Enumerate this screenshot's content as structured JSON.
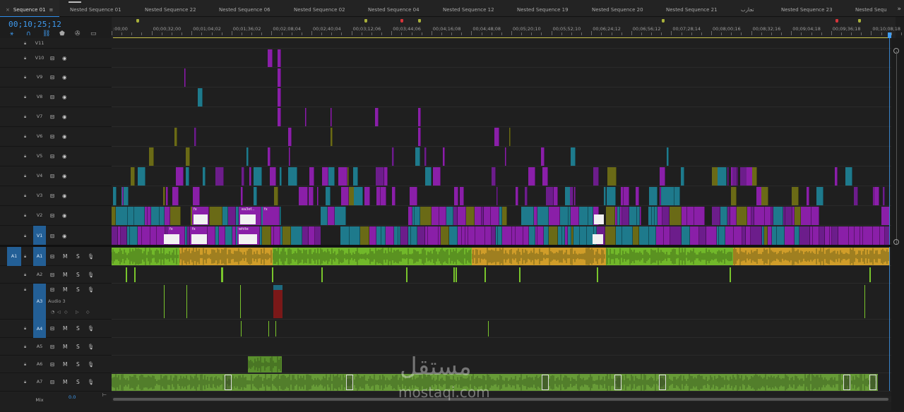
{
  "tabs": [
    {
      "label": "Sequence 01",
      "active": true
    },
    {
      "label": "Nested Sequence 01"
    },
    {
      "label": "Nested Sequence 22"
    },
    {
      "label": "Nested Sequence 06"
    },
    {
      "label": "Nested Sequence 02"
    },
    {
      "label": "Nested Sequence 04"
    },
    {
      "label": "Nested Sequence 12"
    },
    {
      "label": "Nested Sequence 19"
    },
    {
      "label": "Nested Sequence 20"
    },
    {
      "label": "Nested Sequence 21"
    },
    {
      "label": "تجارب"
    },
    {
      "label": "Nested Sequence 23"
    },
    {
      "label": "Nested Sequ"
    }
  ],
  "tab_close_glyph": "×",
  "tab_menu_glyph": "≡",
  "tab_overflow_glyph": "»",
  "timecode": "00;10;25;12",
  "ruler_labels": [
    "00;00",
    "00;00;32;00",
    "00;01;04;02",
    "00;01;36;02",
    "00;02;08;04",
    "00;02;40;04",
    "00;03;12;06",
    "00;03;44;06",
    "00;04;16;08",
    "00;04;48;08",
    "00;05;20;10",
    "00;05;52;10",
    "00;06;24;12",
    "00;06;56;12",
    "00;07;28;14",
    "00;08;00;16",
    "00;08;32;16",
    "00;09;04;18",
    "00;09;36;18",
    "00;10;08;18"
  ],
  "ruler_label_prefix": ":",
  "tools": {
    "snap_icon": "snap-icon",
    "linked_selection_icon": "magnet-link-icon",
    "add_marker_icon": "marker-icon",
    "settings_icon": "wrench-icon",
    "captions_icon": "captions-icon",
    "insert_icon": "sequence-insert-icon"
  },
  "video_tracks": [
    {
      "name": "V11"
    },
    {
      "name": "V10"
    },
    {
      "name": "V9"
    },
    {
      "name": "V8"
    },
    {
      "name": "V7"
    },
    {
      "name": "V6"
    },
    {
      "name": "V5"
    },
    {
      "name": "V4"
    },
    {
      "name": "V3"
    },
    {
      "name": "V2"
    },
    {
      "name": "V1",
      "targeted": true
    }
  ],
  "audio_tracks": [
    {
      "name": "A1",
      "targeted": true,
      "source_patch": "A1"
    },
    {
      "name": "A2"
    },
    {
      "name": "A3",
      "targeted": true,
      "label": "Audio 3"
    },
    {
      "name": "A4",
      "targeted": true
    },
    {
      "name": "A5"
    },
    {
      "name": "A6"
    },
    {
      "name": "A7"
    }
  ],
  "mix": {
    "name": "Mix",
    "value": "0.0"
  },
  "audio_buttons": {
    "mute": "M",
    "solo": "S"
  },
  "clip_labels": {
    "fx": "fx",
    "clip_a": "ea3ef...",
    "clip_b": "white"
  },
  "colors": {
    "purple": "#8a1fa8",
    "violet": "#6c1d8b",
    "teal": "#1e7a8c",
    "olive": "#6a6a16",
    "audio_green": "#79c52c",
    "audio_gold": "#e0a82a",
    "accent_blue": "#3f9cf2",
    "marker_yellow": "#a9b13a",
    "marker_red": "#d8353b"
  },
  "watermark": {
    "arabic": "مستقل",
    "latin": "mostaqi.com"
  }
}
